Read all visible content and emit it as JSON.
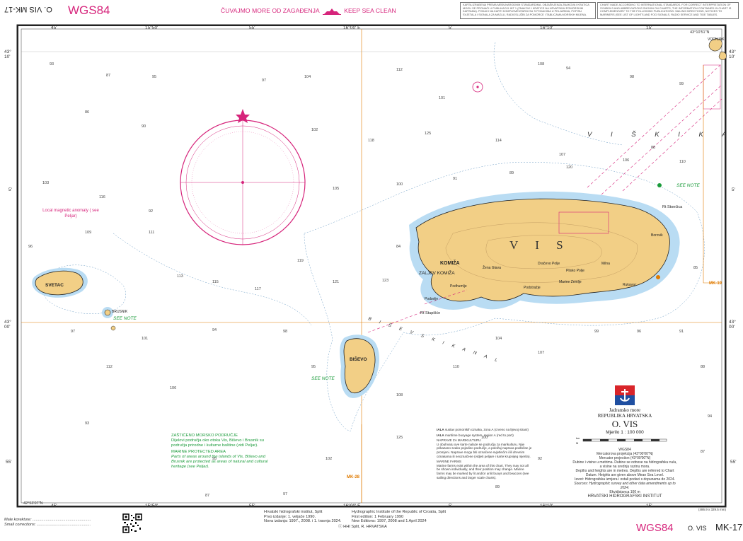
{
  "header": {
    "chart_id_rotated": "O. VIS  MK-17",
    "datum": "WGS84",
    "banner_hr": "ČUVAJMO MORE OD ZAGAĐENJA",
    "banner_en": "KEEP SEA CLEAN",
    "note_hr": "KARTA IZRAĐENA PREMA MEĐUNARODNIM STANDARDIMA. OBJAŠNJENJA ZNAKOVA I KRATICA MOGU SE PRONAĆI U PUBLIKACIJI INT 1 (ZNAKOVI I KRATICE NA HRVATSKIM POMORSKIM KARTAMA). PODACI NA KARTI KOMPLEMENTARNI SU S PODACIMA U PELJARIMA, POPISU SVJETALA I SIGNALA ZA MAGLU, RADIOSLUŽBI ZA POMORCE I TABLICAMA MORSKIH MIJENA.",
    "note_en": "CHART MADE ACCORDING TO INTERNATIONAL STANDARDS. FOR CORRECT INTERPRETATION OF SYMBOLS AND ABBREVIATIONS SHOWN ON CHARTS, THE INFORMATION CONTAINED IN CHART IS COMPLEMENTARY TO THE FOLLOWING PUBLICATIONS: SAILING DIRECTIONS, NOTICES TO MARINERS (SEE LIST OF LIGHTS AND FOG SIGNALS, RADIO SERVICE AND TIDE TABLES."
  },
  "graticule": {
    "top_lon": [
      "45'",
      "15°50'",
      "55'",
      "16°00' E",
      "5'",
      "16°10'",
      "15'"
    ],
    "bottom_lon": [
      "45'",
      "15°50'",
      "55'",
      "16°00' E",
      "5'",
      "16°10'",
      "15'"
    ],
    "left_lat": [
      "43° 10'",
      "5'",
      "43° 00'",
      "55'"
    ],
    "right_lat": [
      "43° 10'",
      "5'",
      "43° 00'",
      "55'"
    ],
    "corner_nw": "43°10'51\"N",
    "corner_sw": "42°53'07\"N"
  },
  "places": {
    "vis": "V I S",
    "komiza": "KOMIŽA",
    "zaljev_komiza": "ZALJEV KOMIŽA",
    "bisevo": "BIŠEVO",
    "svetac": "SVETAC",
    "viski_kanal": "V I Š K I   K A N A L",
    "bisevski_kanal": "B I Š E V S K I   K A N A L",
    "vodnjak": "VODNJAK",
    "brusnik": "BRUSNIK",
    "rt_stupiska": "Rt Stupišće",
    "rt_stoncica": "Rt Stončica",
    "see_note_1": "SEE NOTE",
    "see_note_2": "SEE NOTE",
    "see_note_3": "SEE NOTE",
    "magnetic_anomaly": "Local magnetic anomaly ( see Peljar)",
    "mk19": "MK-19",
    "mk28": "MK-28",
    "viski_inner": [
      "Žena Glava",
      "Podhumlje",
      "Podselje",
      "Podstražje",
      "Marine Zemlje",
      "Plisko Polje",
      "Rukavac",
      "Milna",
      "Dračevo Polje",
      "Borovik"
    ]
  },
  "depths": [
    "93",
    "87",
    "95",
    "97",
    "104",
    "112",
    "101",
    "108",
    "94",
    "98",
    "99",
    "86",
    "90",
    "102",
    "118",
    "125",
    "114",
    "107",
    "88",
    "110",
    "103",
    "116",
    "92",
    "105",
    "100",
    "91",
    "89",
    "120",
    "106",
    "96",
    "109",
    "111",
    "113",
    "115",
    "117",
    "119",
    "121",
    "123",
    "84",
    "85"
  ],
  "mpa": {
    "title_hr": "ZAŠTIĆENO MORSKO PODRUČJE",
    "text_hr": "Dijelovi područja oko otoka Vis, Biševo i Brusnik su područja prirodne i kulturne baštine (vidi Peljar).",
    "title_en": "MARINE PROTECTED AREA",
    "text_en": "Parts of areas around the islands of Vis, Biševo and Brusnik are protected as areas of natural and cultural heritage (see Peljar)."
  },
  "notes": {
    "iala_hr_bold": "IALA",
    "iala_hr": "sustav pomorskih oznaka, zona A (crveno na lijevoj strani)",
    "iala_en_bold": "IALA",
    "iala_en": "maritime buoyage system, region A (red to port)",
    "navi_title_hr": "NAPRAVE ZA MARIKULTURU",
    "navi_text_hr": "U obuhvatu ove karte nalaze se područja za marikulturu. Nije prikazano svako pojedino područje, a položaj naprava podložan je promjeni. Naprave mogu biti označene svjetlećim i/ili drevnim oznakama ili neoznačene (vidjeti peljare i karte krupnijeg mjerila).",
    "farms_title": "MARINE FARMS",
    "farms_text": "Marine farms exist within the area of this chart. They may not all be shown individually, and their position may change. Marine farms may be marked by lit and/or unlit buoys and beacons (see sailing directions and larger scale charts)."
  },
  "title_block": {
    "sea_hr": "Jadransko more",
    "country": "REPUBLIKA HRVATSKA",
    "name": "O. VIS",
    "scale": "Mjerilo 1 : 100 000",
    "datum": "WGS84",
    "projection_hr": "Mercatorova projekcija (43°00'00\"N)",
    "projection_en": "Mercator projection (43°00'00\"N)",
    "depths_hr": "Dubine i visine u metrima. Dubine se odnose na hidrografsku nulu, a visine na srednju razinu mora.",
    "depths_en": "Depths and heights are in metres. Depths are referred to Chart Datum. Heights are given above Mean Sea Level.",
    "source_hr": "Izvori: Hidrografska izmjera i ostali podaci s dopunama do 2024.",
    "source_en": "Sources: Hydrographic survey and other data amendments up to 2024.",
    "equidistance": "Ekvidistanca 100 m",
    "institute": "HRVATSKI HIDROGRAFSKI INSTITUT",
    "scalebar_km": "km",
    "scalebar_nm": "M"
  },
  "footer": {
    "minor_corr_hr": "Male korekture:",
    "minor_corr_en": "Small corrections:",
    "pub_hr_1": "Hrvatski hidrografski institut, Split",
    "pub_hr_2": "Prvo izdanje: 1. veljače 1990.",
    "pub_hr_3": "Nova izdanja: 1997., 2008. i 1. travnja 2024.",
    "pub_en_1": "Hydrographic Institute of the Republic of Croatia, Split",
    "pub_en_2": "First edition: 1 February 1990",
    "pub_en_3": "New Editions: 1997, 2008 and 1 April 2024",
    "copyright": "ⓒ HHI Split, R. HRVATSKA",
    "datum": "WGS84",
    "chart_name": "O. VIS",
    "chart_no": "MK-17",
    "dims": "(486.9 x 329.5 mm)"
  },
  "colors": {
    "land": "#f2cf86",
    "shallow": "#b9dcf3",
    "magenta": "#d6247b",
    "green": "#1a9b3a",
    "orange": "#e07b00"
  }
}
